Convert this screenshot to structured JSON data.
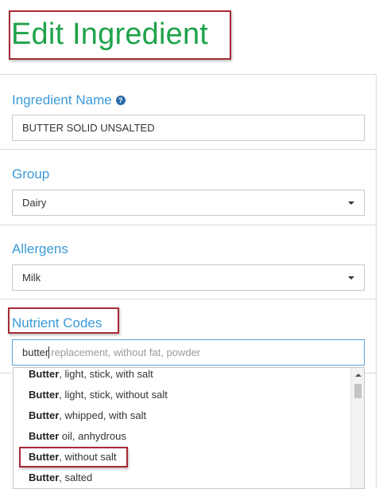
{
  "page": {
    "title": "Edit Ingredient"
  },
  "fields": {
    "ingredient_name": {
      "label": "Ingredient Name",
      "help_icon": "question-circle-icon",
      "value": "BUTTER SOLID UNSALTED"
    },
    "group": {
      "label": "Group",
      "value": "Dairy"
    },
    "allergens": {
      "label": "Allergens",
      "value": "Milk"
    },
    "nutrient_codes": {
      "label": "Nutrient Codes",
      "typed": "butter",
      "hint": "replacement, without fat, powder",
      "suggestions": [
        {
          "bold": "Butter",
          "rest": ", light, stick, with salt"
        },
        {
          "bold": "Butter",
          "rest": ", light, stick, without salt"
        },
        {
          "bold": "Butter",
          "rest": ", whipped, with salt"
        },
        {
          "bold": "Butter",
          "rest": " oil, anhydrous"
        },
        {
          "bold": "Butter",
          "rest": ", without salt"
        },
        {
          "bold": "Butter",
          "rest": ", salted"
        }
      ]
    }
  },
  "colors": {
    "title": "#1fa34a",
    "label": "#3a9ad9",
    "highlight_border": "#a52a36",
    "focus_border": "#5aa5dc"
  }
}
